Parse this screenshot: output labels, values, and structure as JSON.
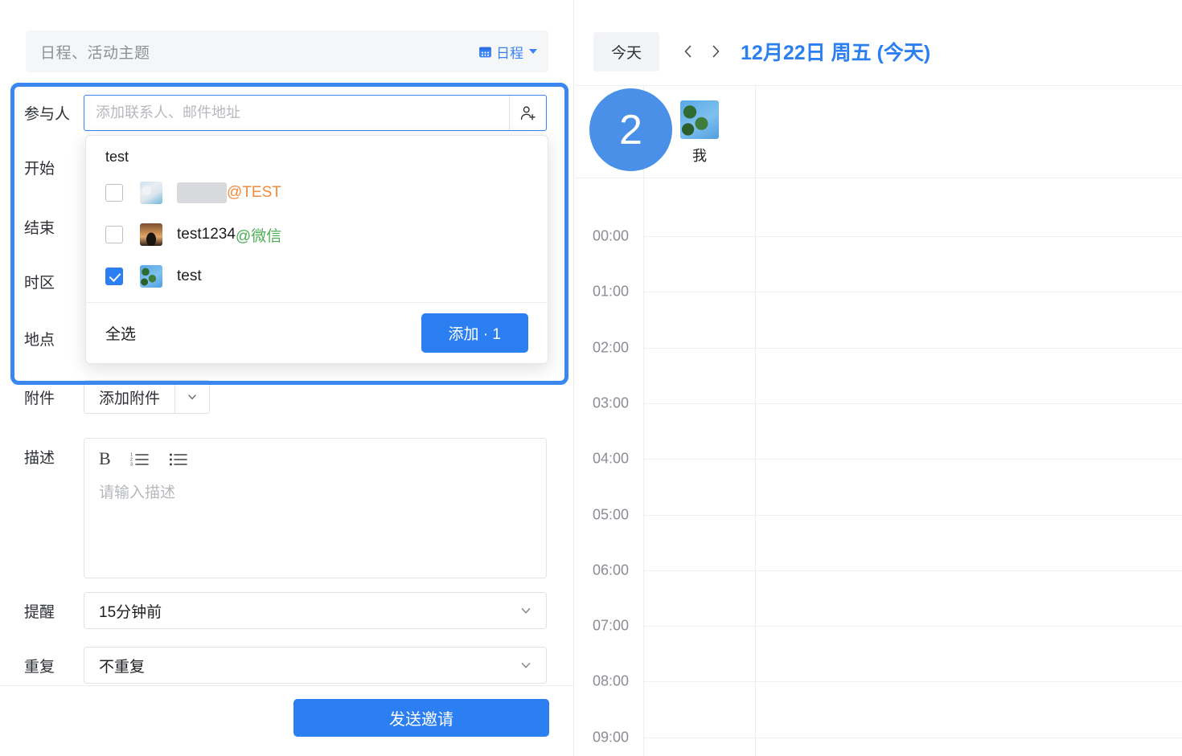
{
  "window": {
    "controls": [
      {
        "name": "minimize",
        "glyph": "minimize-icon"
      },
      {
        "name": "maximize",
        "glyph": "maximize-icon"
      },
      {
        "name": "close",
        "glyph": "close-icon"
      }
    ]
  },
  "editor": {
    "title_placeholder": "日程、活动主题",
    "calendar_type_label": "日程",
    "labels": {
      "participants": "参与人",
      "start": "开始",
      "end": "结束",
      "timezone": "时区",
      "location": "地点",
      "attachment": "附件",
      "description": "描述",
      "reminder": "提醒",
      "repeat": "重复"
    },
    "participants": {
      "value": "",
      "placeholder": "添加联系人、邮件地址",
      "add_contact_icon": "person-add-icon"
    },
    "attachment": {
      "button_label": "添加附件"
    },
    "description": {
      "placeholder": "请输入描述",
      "tools": [
        {
          "name": "bold",
          "label": "B"
        },
        {
          "name": "ordered-list",
          "label": "ordered-list-icon"
        },
        {
          "name": "unordered-list",
          "label": "unordered-list-icon"
        }
      ]
    },
    "reminder": {
      "value": "15分钟前"
    },
    "repeat": {
      "value": "不重复"
    },
    "send_label": "发送邀请"
  },
  "dropdown": {
    "group_label": "test",
    "items": [
      {
        "name": "",
        "name_redacted": true,
        "domain": "@TEST",
        "domain_color": "#f08a3c",
        "checked": false,
        "avatar": "av-1"
      },
      {
        "name": "test1234",
        "name_redacted": false,
        "domain": "@微信",
        "domain_color": "#4cae55",
        "checked": false,
        "avatar": "av-2"
      },
      {
        "name": "test",
        "name_redacted": false,
        "domain": "",
        "domain_color": "",
        "checked": true,
        "avatar": "av-3"
      }
    ],
    "select_all_label": "全选",
    "add_button_label": "添加 · 1"
  },
  "calendar": {
    "today_label": "今天",
    "prev_icon": "chevron-left-icon",
    "next_icon": "chevron-right-icon",
    "date_title": "12月22日 周五 (今天)",
    "self_label": "我",
    "hours": [
      "00:00",
      "01:00",
      "02:00",
      "03:00",
      "04:00",
      "05:00",
      "06:00",
      "07:00",
      "08:00",
      "09:00"
    ]
  },
  "annotation": {
    "step_number": "2"
  },
  "colors": {
    "accent_blue": "#2b7ff0",
    "highlight_border": "#3b87f0",
    "badge_blue": "#4a90e8",
    "domain_orange": "#f08a3c",
    "domain_green": "#4cae55"
  }
}
